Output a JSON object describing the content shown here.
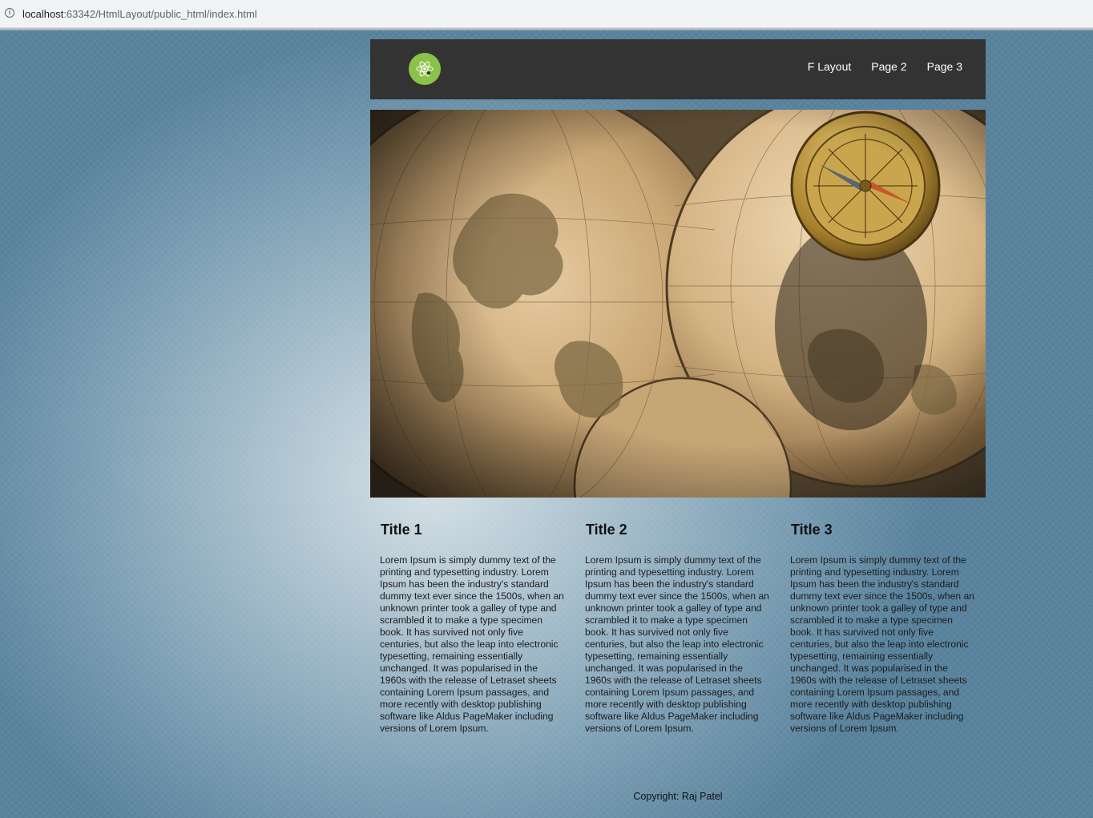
{
  "browser": {
    "url_host": "localhost",
    "url_rest": ":63342/HtmlLayout/public_html/index.html"
  },
  "nav": {
    "items": [
      {
        "label": "F Layout"
      },
      {
        "label": "Page 2"
      },
      {
        "label": "Page 3"
      }
    ]
  },
  "hero": {
    "image": "vintage-world-map-with-compass"
  },
  "columns": [
    {
      "title": "Title 1",
      "body": "Lorem Ipsum is simply dummy text of the printing and typesetting industry. Lorem Ipsum has been the industry's standard dummy text ever since the 1500s, when an unknown printer took a galley of type and scrambled it to make a type specimen book. It has survived not only five centuries, but also the leap into electronic typesetting, remaining essentially unchanged. It was popularised in the 1960s with the release of Letraset sheets containing Lorem Ipsum passages, and more recently with desktop publishing software like Aldus PageMaker including versions of Lorem Ipsum."
    },
    {
      "title": "Title 2",
      "body": "Lorem Ipsum is simply dummy text of the printing and typesetting industry. Lorem Ipsum has been the industry's standard dummy text ever since the 1500s, when an unknown printer took a galley of type and scrambled it to make a type specimen book. It has survived not only five centuries, but also the leap into electronic typesetting, remaining essentially unchanged. It was popularised in the 1960s with the release of Letraset sheets containing Lorem Ipsum passages, and more recently with desktop publishing software like Aldus PageMaker including versions of Lorem Ipsum."
    },
    {
      "title": "Title 3",
      "body": "Lorem Ipsum is simply dummy text of the printing and typesetting industry. Lorem Ipsum has been the industry's standard dummy text ever since the 1500s, when an unknown printer took a galley of type and scrambled it to make a type specimen book. It has survived not only five centuries, but also the leap into electronic typesetting, remaining essentially unchanged. It was popularised in the 1960s with the release of Letraset sheets containing Lorem Ipsum passages, and more recently with desktop publishing software like Aldus PageMaker including versions of Lorem Ipsum."
    }
  ],
  "footer": {
    "copyright": "Copyright: Raj Patel"
  },
  "colors": {
    "header_bg": "#333333",
    "logo_bg": "#8bc34a",
    "nav_text": "#ffffff"
  }
}
